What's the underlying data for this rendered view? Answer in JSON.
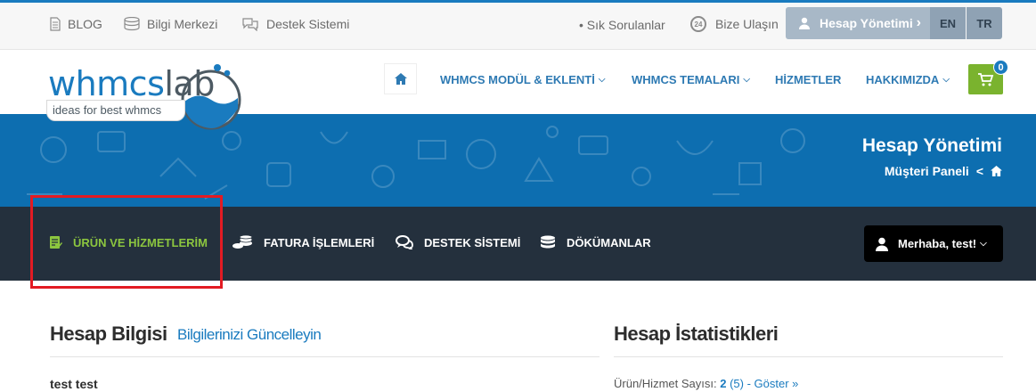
{
  "topbar": {
    "blog": "BLOG",
    "knowledge": "Bilgi Merkezi",
    "support": "Destek Sistemi",
    "faq": "• Sık Sorulanlar",
    "contact": "Bize Ulaşın",
    "account_button": "Hesap Yönetimi",
    "lang_en": "EN",
    "lang_tr": "TR"
  },
  "logo": {
    "brand_a": "whmcs",
    "brand_b": "lab",
    "tagline": "ideas for best whmcs"
  },
  "nav": {
    "items": [
      {
        "label": "WHMCS MODÜL & EKLENTİ",
        "caret": "⌵"
      },
      {
        "label": "WHMCS TEMALARI",
        "caret": "⌵"
      },
      {
        "label": "HİZMETLER"
      },
      {
        "label": "HAKKIMIZDA",
        "caret": "⌵"
      }
    ],
    "cart_count": "0"
  },
  "hero": {
    "title": "Hesap Yönetimi",
    "breadcrumb": "Müşteri Paneli",
    "separator": "<"
  },
  "client_nav": {
    "items": [
      {
        "label": "ÜRÜN VE HİZMETLERİM",
        "active": true
      },
      {
        "label": "FATURA İŞLEMLERİ"
      },
      {
        "label": "DESTEK SİSTEMİ"
      },
      {
        "label": "DÖKÜMANLAR"
      }
    ],
    "user_greeting": "Merhaba, test!"
  },
  "content": {
    "account_heading": "Hesap Bilgisi",
    "update_link": "Bilgilerinizi Güncelleyin",
    "stats_heading": "Hesap İstatistikleri",
    "user_name": "test test",
    "stat_label": "Ürün/Hizmet Sayısı:",
    "stat_value": "2",
    "stat_total": "(5)",
    "stat_link": "- Göster »"
  },
  "colors": {
    "brand_blue": "#1a7bbf",
    "active_green": "#8cc63f",
    "dark_nav": "#24303d",
    "highlight": "#e31b23"
  }
}
